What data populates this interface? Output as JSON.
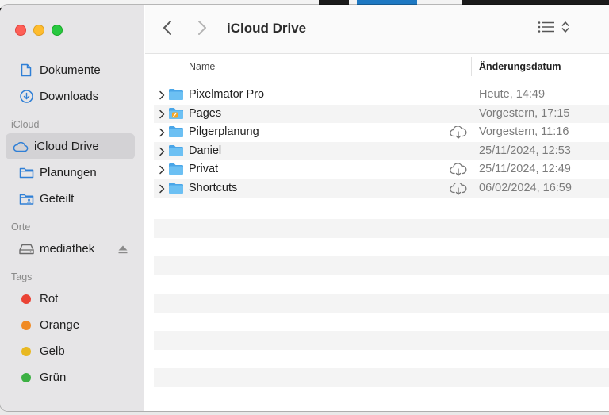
{
  "window": {
    "title": "iCloud Drive"
  },
  "sidebar": {
    "favorites": [
      {
        "label": "Dokumente",
        "icon": "document-icon"
      },
      {
        "label": "Downloads",
        "icon": "download-icon"
      }
    ],
    "icloud_header": "iCloud",
    "icloud": [
      {
        "label": "iCloud Drive",
        "icon": "cloud-icon",
        "selected": true
      },
      {
        "label": "Planungen",
        "icon": "folder-icon"
      },
      {
        "label": "Geteilt",
        "icon": "shared-folder-icon"
      }
    ],
    "orte_header": "Orte",
    "orte": [
      {
        "label": "mediathek",
        "icon": "drive-icon"
      }
    ],
    "tags_header": "Tags",
    "tags": [
      {
        "label": "Rot",
        "color": "#ea4335"
      },
      {
        "label": "Orange",
        "color": "#f08a24"
      },
      {
        "label": "Gelb",
        "color": "#e8b821"
      },
      {
        "label": "Grün",
        "color": "#3cb043"
      }
    ]
  },
  "columns": {
    "name": "Name",
    "date": "Änderungsdatum"
  },
  "files": [
    {
      "name": "Pixelmator Pro",
      "date": "Heute, 14:49",
      "cloud": false
    },
    {
      "name": "Pages",
      "date": "Vorgestern, 17:15",
      "cloud": false
    },
    {
      "name": "Pilgerplanung",
      "date": "Vorgestern, 11:16",
      "cloud": true
    },
    {
      "name": "Daniel",
      "date": "25/11/2024, 12:53",
      "cloud": false
    },
    {
      "name": "Privat",
      "date": "25/11/2024, 12:49",
      "cloud": true
    },
    {
      "name": "Shortcuts",
      "date": "06/02/2024, 16:59",
      "cloud": true
    }
  ],
  "colors": {
    "folder": "#5bb8ef",
    "accent": "#1e78c2",
    "sidebar_bg": "#e6e5e7"
  }
}
